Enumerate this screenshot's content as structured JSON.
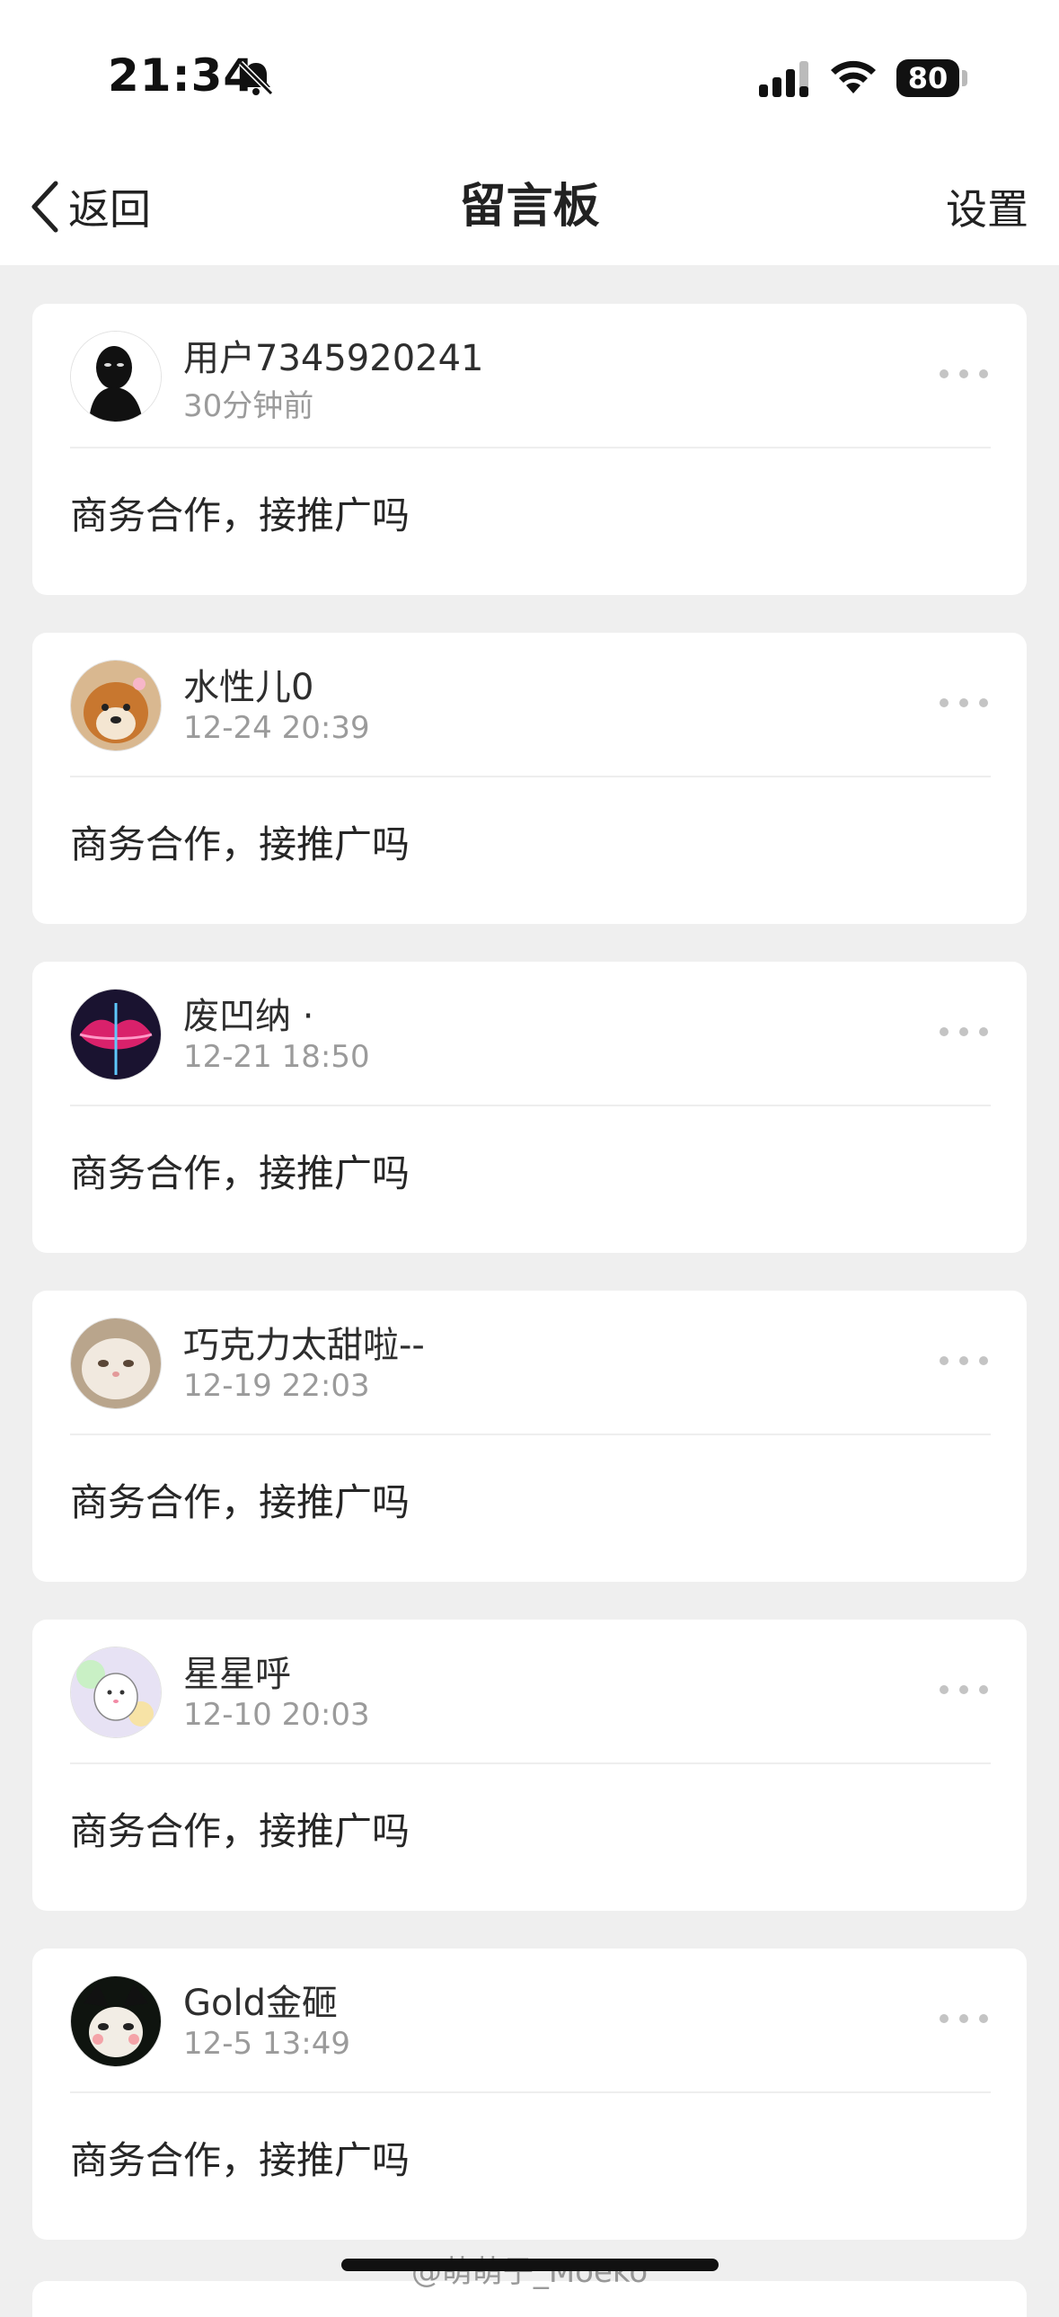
{
  "status_bar": {
    "time": "21:34",
    "battery": "80"
  },
  "nav": {
    "back_label": "返回",
    "title": "留言板",
    "settings_label": "设置"
  },
  "messages": [
    {
      "username": "用户7345920241",
      "time": "30分钟前",
      "text": "商务合作，接推广吗",
      "avatar": "silhouette-avatar"
    },
    {
      "username": "水性儿0",
      "time": "12-24 20:39",
      "text": "商务合作，接推广吗",
      "avatar": "dog-avatar"
    },
    {
      "username": "废凹纳 ·",
      "time": "12-21 18:50",
      "text": "商务合作，接推广吗",
      "avatar": "lips-avatar"
    },
    {
      "username": "巧克力太甜啦--",
      "time": "12-19 22:03",
      "text": "商务合作，接推广吗",
      "avatar": "cat-avatar"
    },
    {
      "username": "星星呼",
      "time": "12-10 20:03",
      "text": "商务合作，接推广吗",
      "avatar": "cartoon-avatar"
    },
    {
      "username": "Gold金砸",
      "time": "12-5 13:49",
      "text": "商务合作，接推广吗",
      "avatar": "black-cat-avatar"
    }
  ],
  "watermark": "@萌萌子_Moeko",
  "colors": {
    "background": "#efefef",
    "card": "#ffffff",
    "secondary_text": "#9b9b9b"
  }
}
